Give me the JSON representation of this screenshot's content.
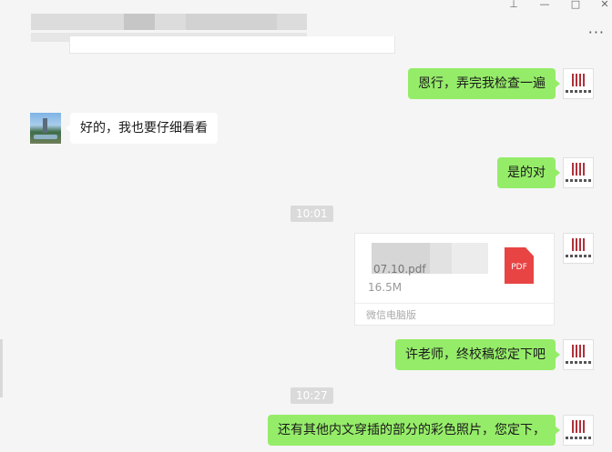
{
  "window": {
    "controls": [
      "pin",
      "minimize",
      "maximize",
      "close"
    ],
    "more_label": "···"
  },
  "messages": [
    {
      "from": "me",
      "text": "恩行，弄完我检查一遍"
    },
    {
      "from": "other",
      "text": "好的，我也要仔细看看"
    },
    {
      "from": "me",
      "text": "是的对"
    },
    {
      "type": "time",
      "text": "10:01"
    },
    {
      "from": "me",
      "type": "file",
      "file_name_visible": "07.10.pdf",
      "file_size": "16.5M",
      "source": "微信电脑版",
      "file_icon_label": "PDF"
    },
    {
      "from": "me",
      "text": "许老师，终校稿您定下吧"
    },
    {
      "type": "time",
      "text": "10:27"
    },
    {
      "from": "me",
      "text": "还有其他内文穿插的部分的彩色照片，您定下，"
    }
  ],
  "colors": {
    "sent_bubble": "#95ec69",
    "received_bubble": "#ffffff",
    "background": "#f5f5f5",
    "pdf_icon": "#e84444"
  }
}
